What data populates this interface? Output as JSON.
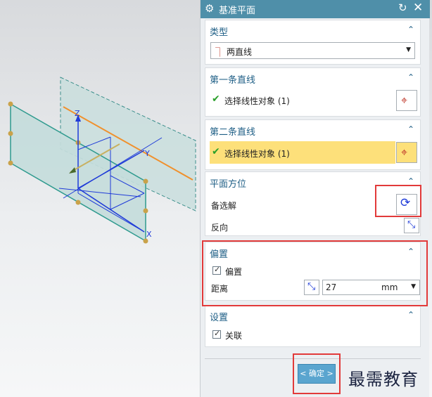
{
  "dialog": {
    "title": "基准平面"
  },
  "type_section": {
    "header": "类型",
    "selected": "两直线"
  },
  "first_line": {
    "header": "第一条直线",
    "label": "选择线性对象 (1)"
  },
  "second_line": {
    "header": "第二条直线",
    "label": "选择线性对象 (1)"
  },
  "orientation": {
    "header": "平面方位",
    "alternate_label": "备选解",
    "reverse_label": "反向"
  },
  "offset": {
    "header": "偏置",
    "checkbox_label": "偏置",
    "distance_label": "距离",
    "distance_value": "27",
    "unit": "mm"
  },
  "settings": {
    "header": "设置",
    "associative_label": "关联"
  },
  "footer": {
    "ok_label": "< 确定 >"
  },
  "viewport": {
    "axis_z": "Z",
    "axis_y": "Y",
    "axis_x": "X"
  },
  "watermark": "最需教育",
  "colors": {
    "titlebar": "#4f8fa9",
    "header_text": "#1f5f86",
    "highlight_row": "#fde07a",
    "plane_fill": "#cde4e3",
    "plane_edge": "#3d8f8c",
    "line_orange": "#f0902c",
    "axis_blue": "#1f3bd8",
    "callout_red": "#e23a3a"
  }
}
